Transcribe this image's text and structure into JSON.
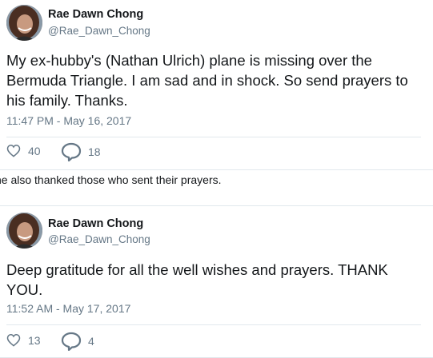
{
  "tweets": [
    {
      "author_name": "Rae Dawn Chong",
      "handle": "@Rae_Dawn_Chong",
      "text": "My ex-hubby's (Nathan Ulrich) plane is missing over the Bermuda Triangle. I am sad and in shock. So send prayers to his family. Thanks.",
      "timestamp": "11:47 PM - May 16, 2017",
      "likes": "40",
      "replies": "18"
    },
    {
      "author_name": "Rae Dawn Chong",
      "handle": "@Rae_Dawn_Chong",
      "text": "Deep gratitude for all the well wishes and prayers. THANK YOU.",
      "timestamp": "11:52 AM - May 17, 2017",
      "likes": "13",
      "replies": "4"
    }
  ],
  "caption": "he also thanked those who sent their prayers.",
  "icons": {
    "like": "heart-icon",
    "reply": "speech-bubble-icon"
  },
  "colors": {
    "text": "#14171a",
    "secondary": "#657786",
    "border": "#e1e8ed"
  }
}
